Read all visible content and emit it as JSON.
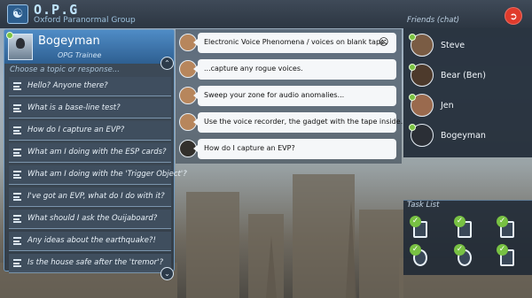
{
  "app": {
    "title": "O.P.G",
    "subtitle": "Oxford Paranormal Group"
  },
  "npc": {
    "name": "Bogeyman",
    "role": "OPG Trainee"
  },
  "topics": {
    "hint": "Choose a topic or response...",
    "items": [
      "Hello? Anyone there?",
      "What is a base-line test?",
      "How do I capture an EVP?",
      "What am I doing with the ESP cards?",
      "What am I doing with the 'Trigger Object'?",
      "I've got an EVP, what do I do with it?",
      "What should I ask the Ouijaboard?",
      "Any ideas about the earthquake?!",
      "Is the house safe after the 'tremor'?"
    ]
  },
  "chat": {
    "messages": [
      "Electronic Voice Phenomena / voices on blank tape.",
      "...capture any rogue voices.",
      "Sweep your zone for audio anomalies...",
      "Use the voice recorder, the gadget with the tape inside.",
      "How do I capture an EVP?"
    ]
  },
  "friends": {
    "title": "Friends (chat)",
    "items": [
      "Steve",
      "Bear (Ben)",
      "Jen",
      "Bogeyman"
    ]
  },
  "tasks": {
    "title": "Task List",
    "icons": [
      "phone-task-icon",
      "cards-task-icon",
      "radio-task-icon",
      "head-task-icon",
      "recorder-task-icon",
      "camera-task-icon"
    ],
    "completed": [
      true,
      true,
      true,
      true,
      true,
      true
    ]
  },
  "colors": {
    "accent": "#4f8cc6",
    "online": "#7cc242",
    "exit": "#e03b2c"
  }
}
